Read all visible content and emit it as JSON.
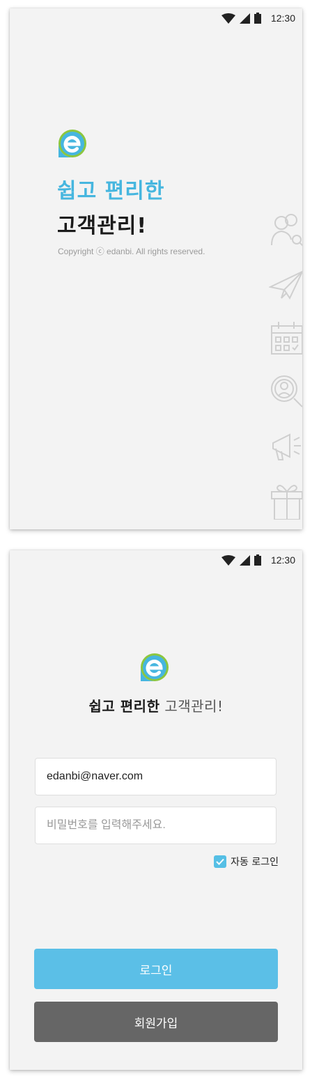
{
  "screen1": {
    "status": {
      "time": "12:30"
    },
    "tagline_line1": "쉽고 편리한",
    "tagline_line2": "고객관리!",
    "copyright": "Copyright ⓒ edanbi. All rights reserved.",
    "side_icons": [
      "users-search-icon",
      "paper-plane-icon",
      "calendar-icon",
      "person-search-icon",
      "megaphone-icon",
      "gift-icon"
    ]
  },
  "screen2": {
    "status": {
      "time": "12:30"
    },
    "title_bold": "쉽고 편리한",
    "title_light": "고객관리!",
    "email": {
      "value": "edanbi@naver.com"
    },
    "password": {
      "placeholder": "비밀번호를 입력해주세요."
    },
    "auto_login": {
      "label": "자동 로그인",
      "checked": true
    },
    "login_button": "로그인",
    "signup_button": "회원가입"
  },
  "colors": {
    "brand_blue": "#46b6df",
    "brand_green": "#8cc63f",
    "login_button": "#5bbfe7",
    "signup_button": "#666666",
    "screen_bg": "#f3f3f3"
  }
}
